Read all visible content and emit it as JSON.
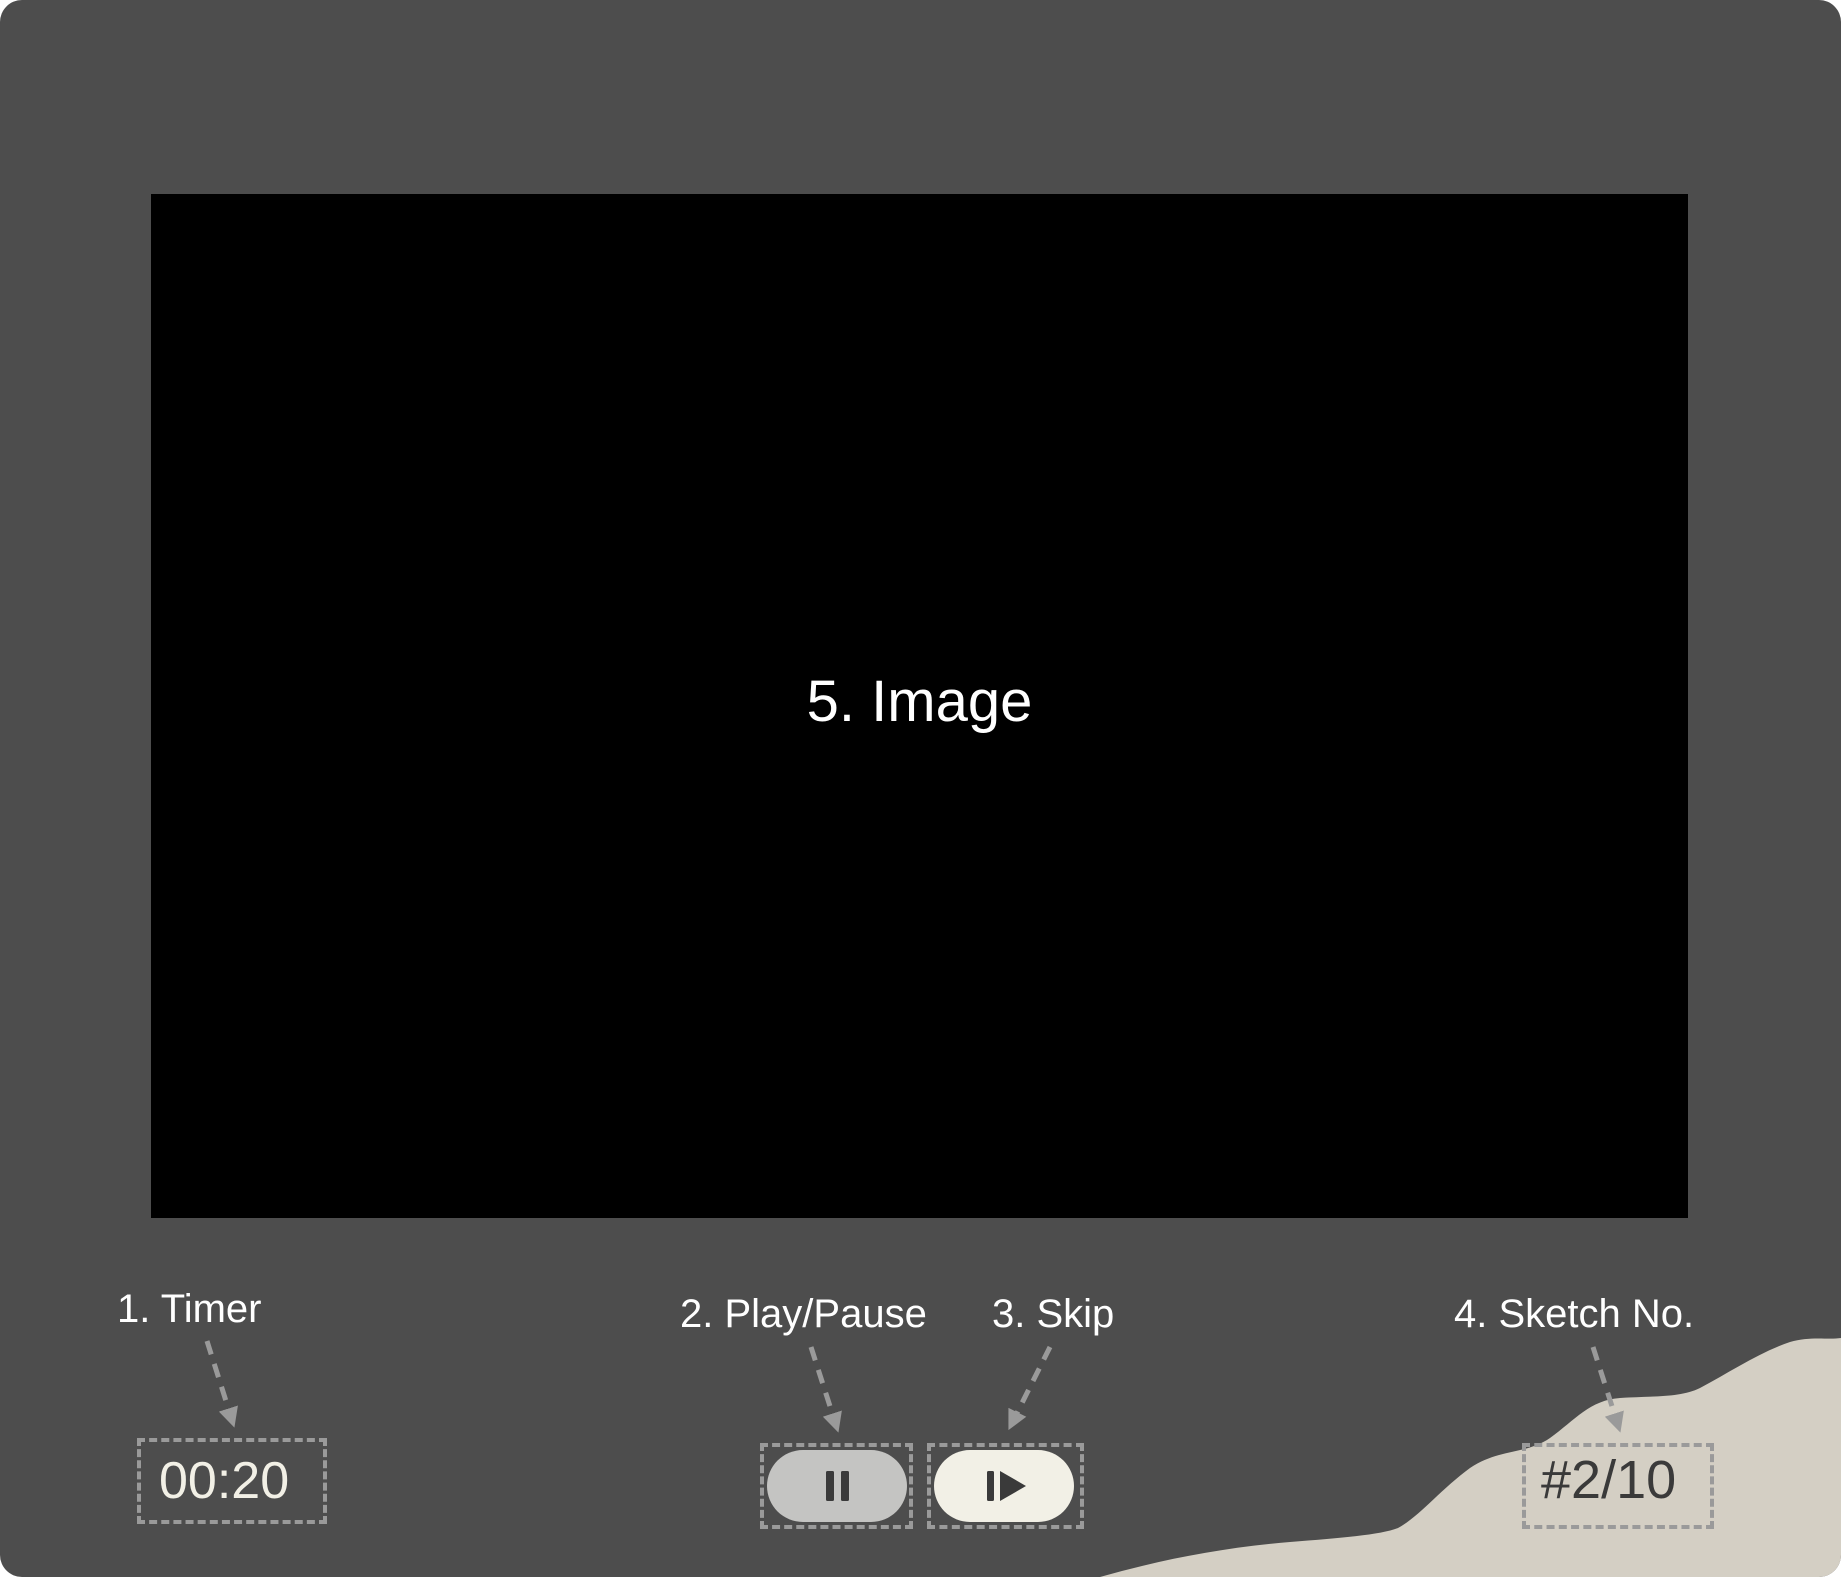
{
  "viewport": {
    "label": "5. Image"
  },
  "callouts": {
    "timer": "1. Timer",
    "play_pause": "2. Play/Pause",
    "skip": "3. Skip",
    "sketch_no": "4. Sketch No."
  },
  "controls": {
    "timer_value": "00:20",
    "sketch_count": "#2/10",
    "pause_icon": "pause-icon",
    "skip_icon": "skip-next-icon"
  },
  "colors": {
    "background": "#4d4d4d",
    "viewport": "#000000",
    "paper": "#d4cfc4",
    "pause_button": "#c4c4c2",
    "skip_button": "#f2f0e6",
    "dashed_annotation": "#9a9a9a"
  }
}
